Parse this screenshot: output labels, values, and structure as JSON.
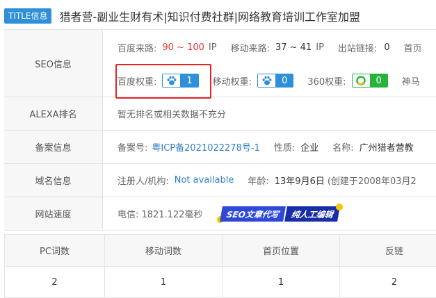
{
  "title": {
    "badge": "TITLE信息",
    "text": "猎者营-副业生财有术|知识付费社群|网络教育培训工作室加盟"
  },
  "seo": {
    "label": "SEO信息",
    "baidu_traffic": {
      "key": "百度来路:",
      "value": "90 ~ 100",
      "unit": "IP"
    },
    "mobile_traffic": {
      "key": "移动来路:",
      "value": "37 ~ 41",
      "unit": "IP"
    },
    "outbound": {
      "key": "出站链接:",
      "value": "0"
    },
    "home_cut": "首页",
    "baidu_weight": {
      "key": "百度权重:",
      "value": "1",
      "icon": "baidu-paw-icon"
    },
    "mobile_weight": {
      "key": "移动权重:",
      "value": "0",
      "icon": "baidu-paw-icon"
    },
    "weight_360": {
      "key": "360权重:",
      "value": "0",
      "icon": "360-icon"
    },
    "shenma_cut": "神马"
  },
  "alexa": {
    "label": "ALEXA排名",
    "value": "暂无排名或相关数据不充分"
  },
  "icp": {
    "label": "备案信息",
    "number_key": "备案号:",
    "number_value": "粤ICP备2021022278号-1",
    "nature_key": "性质:",
    "nature_value": "企业",
    "name_key": "名称:",
    "name_value": "广州猎者营教"
  },
  "domain": {
    "label": "域名信息",
    "registrant_key": "注册人/机构:",
    "registrant_value": "Not available",
    "age_key": "年龄:",
    "age_value": "13年9月6日",
    "created": "(创建于2008年03月2"
  },
  "speed": {
    "label": "网站速度",
    "telecom": "电信: 1821.122毫秒",
    "promo_1": "SEO文章代写",
    "promo_2": "纯人工编辑"
  },
  "stats": {
    "headers": [
      "PC词数",
      "移动词数",
      "首页位置",
      "反链"
    ],
    "values": [
      "2",
      "1",
      "1",
      "2"
    ]
  },
  "colors": {
    "accent_blue": "#2f8fd8",
    "green": "#27b33a",
    "red": "#e33333"
  }
}
